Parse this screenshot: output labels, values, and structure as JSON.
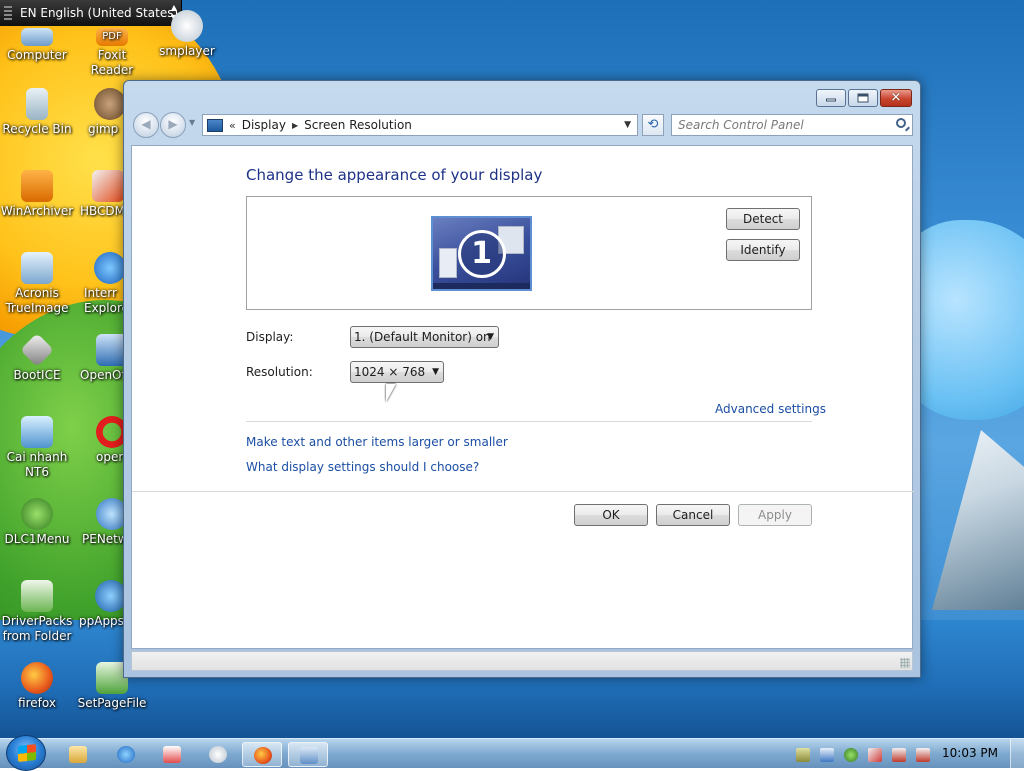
{
  "language_bar": {
    "label": "EN English (United States)"
  },
  "desktop_icons": [
    {
      "label": "Computer"
    },
    {
      "label": "Foxit Reader",
      "badge": "PDF"
    },
    {
      "label": "smplayer"
    },
    {
      "label": "Recycle Bin"
    },
    {
      "label": "gimp"
    },
    {
      "label": "WinArchiver"
    },
    {
      "label": "HBCDM"
    },
    {
      "label": "Acronis TrueImage"
    },
    {
      "label": "Interr Explore"
    },
    {
      "label": "BootICE"
    },
    {
      "label": "OpenOf"
    },
    {
      "label": "Cai nhanh NT6"
    },
    {
      "label": "oper"
    },
    {
      "label": "DLC1Menu"
    },
    {
      "label": "PENetw"
    },
    {
      "label": "DriverPacks from Folder"
    },
    {
      "label": "ppAppsV"
    },
    {
      "label": "firefox"
    },
    {
      "label": "SetPageFile"
    }
  ],
  "window": {
    "caption_buttons": {
      "minimize": "minimize",
      "maximize": "maximize",
      "close": "✕"
    },
    "address": {
      "chevron": "«",
      "segments": [
        "Display",
        "Screen Resolution"
      ],
      "separator": "▶"
    },
    "search": {
      "placeholder": "Search Control Panel"
    },
    "content": {
      "title": "Change the appearance of your display",
      "monitor_number": "1",
      "detect_label": "Detect",
      "identify_label": "Identify",
      "display_label": "Display:",
      "display_value": "1. (Default Monitor) on",
      "resolution_label": "Resolution:",
      "resolution_value": "1024 × 768",
      "advanced_link": "Advanced settings",
      "link_text_size": "Make text and other items larger or smaller",
      "link_help": "What display settings should I choose?",
      "ok_label": "OK",
      "cancel_label": "Cancel",
      "apply_label": "Apply"
    }
  },
  "taskbar": {
    "clock": "10:03 PM"
  },
  "colors": {
    "link": "#1b4ea4",
    "title": "#1e3287"
  }
}
